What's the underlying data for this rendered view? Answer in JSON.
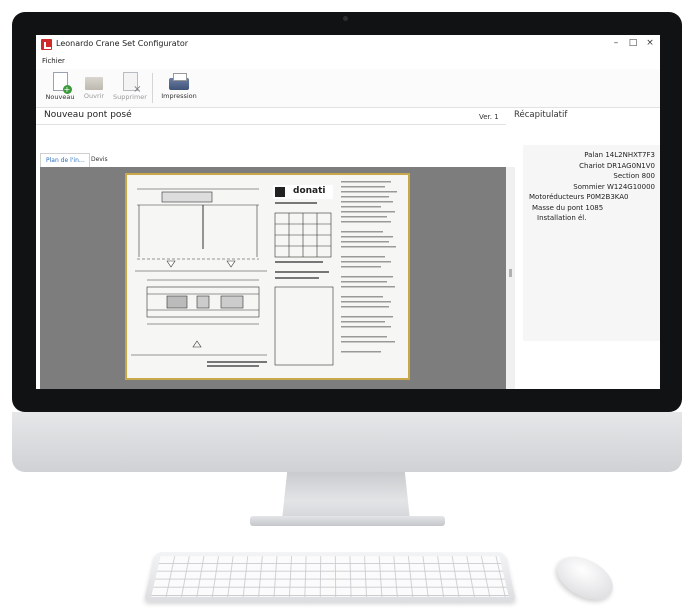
{
  "window": {
    "title": "Leonardo Crane Set Configurator",
    "minimize": "–",
    "maximize": "□",
    "close": "×"
  },
  "menu": {
    "file": "Fichier"
  },
  "toolbar": {
    "new": {
      "label": "Nouveau",
      "icon": "new-document-icon",
      "enabled": true
    },
    "open": {
      "label": "Ouvrir",
      "icon": "folder-open-icon",
      "enabled": false
    },
    "delete": {
      "label": "Supprimer",
      "icon": "delete-document-icon",
      "enabled": false
    },
    "print": {
      "label": "Impression",
      "icon": "printer-icon",
      "enabled": true
    }
  },
  "document": {
    "title": "Nouveau pont posé",
    "version": "Ver. 1"
  },
  "tabs": [
    {
      "label": "Plan de l'in…",
      "active": true
    },
    {
      "label": "Devis",
      "active": false
    }
  ],
  "drawing": {
    "brand": "donati"
  },
  "recap": {
    "title": "Récapitulatif",
    "items": [
      "Palan 14L2NHXT7F3",
      "Chariot DR1AG0N1V0",
      "Section 800",
      "Sommier W124G10000",
      "Motoréducteurs P0M2B3KA0",
      "Masse du pont 1085",
      "Installation él."
    ]
  },
  "colors": {
    "accent": "#2a6fc0",
    "brand_red": "#d12a2a",
    "frame_gold": "#c9a84a",
    "viewer_bg": "#7d7d7d"
  }
}
